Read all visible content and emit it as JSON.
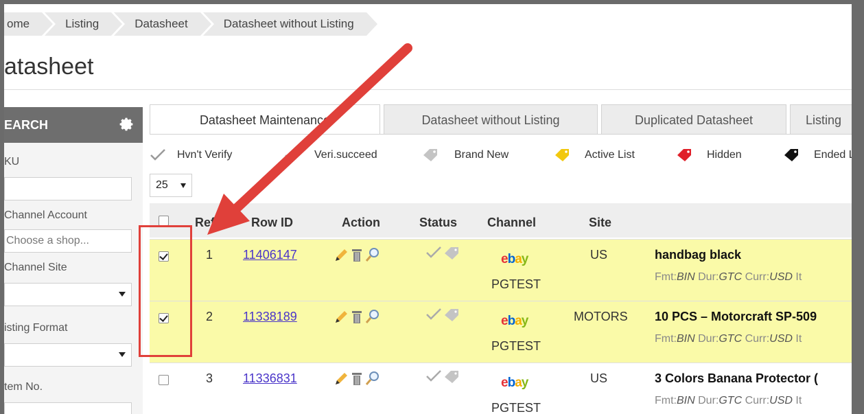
{
  "breadcrumb": [
    "ome",
    "Listing",
    "Datasheet",
    "Datasheet without Listing"
  ],
  "page_title": "atasheet",
  "sidebar": {
    "header": "EARCH",
    "fields": [
      {
        "label": "KU",
        "value": "",
        "type": "input"
      },
      {
        "label": "Channel Account",
        "value": "Choose a shop...",
        "type": "input"
      },
      {
        "label": "Channel Site",
        "value": "",
        "type": "select"
      },
      {
        "label": "isting Format",
        "value": "",
        "type": "select"
      },
      {
        "label": "tem No.",
        "value": "",
        "type": "input"
      }
    ]
  },
  "tabs": [
    "Datasheet Maintenance",
    "Datasheet without Listing",
    "Duplicated Datasheet",
    "Listing"
  ],
  "legend": [
    "Hvn't Verify",
    "Veri.succeed",
    "Brand New",
    "Active List",
    "Hidden",
    "Ended L"
  ],
  "page_size": "25",
  "table": {
    "headers": {
      "ref": "Ref",
      "row_id": "Row ID",
      "action": "Action",
      "status": "Status",
      "channel": "Channel",
      "site": "Site"
    },
    "rows": [
      {
        "selected": true,
        "ref": "1",
        "row_id": "11406147",
        "channel": "ebay",
        "account": "PGTEST",
        "site": "US",
        "title": "handbag black",
        "fmt": "BIN",
        "dur": "GTC",
        "curr": "USD"
      },
      {
        "selected": true,
        "ref": "2",
        "row_id": "11338189",
        "channel": "ebay",
        "account": "PGTEST",
        "site": "MOTORS",
        "title": "10 PCS – Motorcraft SP-509",
        "fmt": "BIN",
        "dur": "GTC",
        "curr": "USD"
      },
      {
        "selected": false,
        "ref": "3",
        "row_id": "11336831",
        "channel": "ebay",
        "account": "PGTEST",
        "site": "US",
        "title": "3 Colors Banana Protector (",
        "fmt": "BIN",
        "dur": "GTC",
        "curr": "USD"
      }
    ],
    "meta_labels": {
      "fmt": "Fmt:",
      "dur": "Dur:",
      "curr": "Curr:",
      "trail": "It"
    }
  },
  "colors": {
    "accent_red": "#e0403a",
    "selected_row": "#fafaa8",
    "link": "#4a35c9",
    "sidebar_header": "#6e6e6e"
  }
}
